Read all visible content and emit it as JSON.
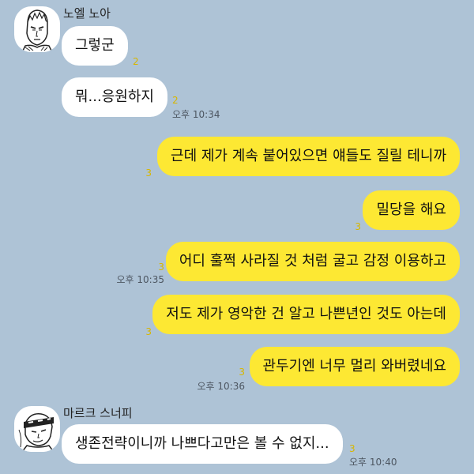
{
  "chat": {
    "participants": [
      {
        "name": "노엘 노아"
      },
      {
        "name": "마르크 스너피"
      }
    ],
    "messages": [
      {
        "side": "in",
        "text": "그렇군",
        "unread": "2"
      },
      {
        "side": "in",
        "text": "뭐...응원하지",
        "unread": "2",
        "time": "오후 10:34"
      },
      {
        "side": "out",
        "text": "근데 제가 계속 붙어있으면 얘들도 질릴 테니까",
        "unread": "3"
      },
      {
        "side": "out",
        "text": "밀당을 해요",
        "unread": "3"
      },
      {
        "side": "out",
        "text": "어디 훌쩍 사라질 것 처럼 굴고 감정 이용하고",
        "unread": "3",
        "time": "오후 10:35"
      },
      {
        "side": "out",
        "text": "저도 제가 영악한 건 알고 나쁜년인 것도 아는데",
        "unread": "3"
      },
      {
        "side": "out",
        "text": "관두기엔 너무 멀리 와버렸네요",
        "unread": "3",
        "time": "오후 10:36"
      },
      {
        "side": "in",
        "text": "생존전략이니까 나쁘다고만은 볼 수 없지...",
        "unread": "3",
        "time": "오후 10:40"
      }
    ]
  },
  "colors": {
    "background": "#aec3d6",
    "incoming_bubble": "#ffffff",
    "outgoing_bubble": "#fde833",
    "unread_count": "#d7b600"
  }
}
